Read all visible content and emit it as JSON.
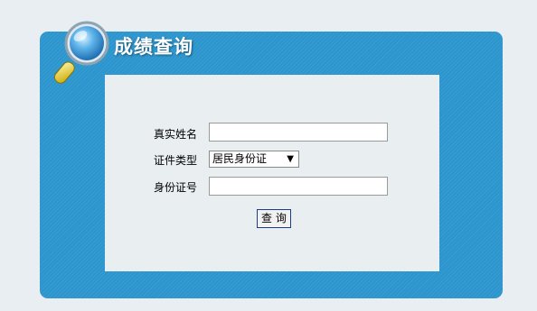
{
  "header": {
    "title": "成绩查询"
  },
  "form": {
    "name_label": "真实姓名",
    "name_value": "",
    "id_type_label": "证件类型",
    "id_type_selected": "居民身份证",
    "id_number_label": "身份证号",
    "id_number_value": "",
    "submit_label": "查 询"
  },
  "colors": {
    "panel": "#2b95cd",
    "content_bg": "#e9eef1",
    "page_bg": "#e8eef1",
    "title_text": "#ffffff"
  },
  "icons": {
    "header_icon": "magnifier-icon",
    "select_arrow": "triangle-down-icon"
  }
}
